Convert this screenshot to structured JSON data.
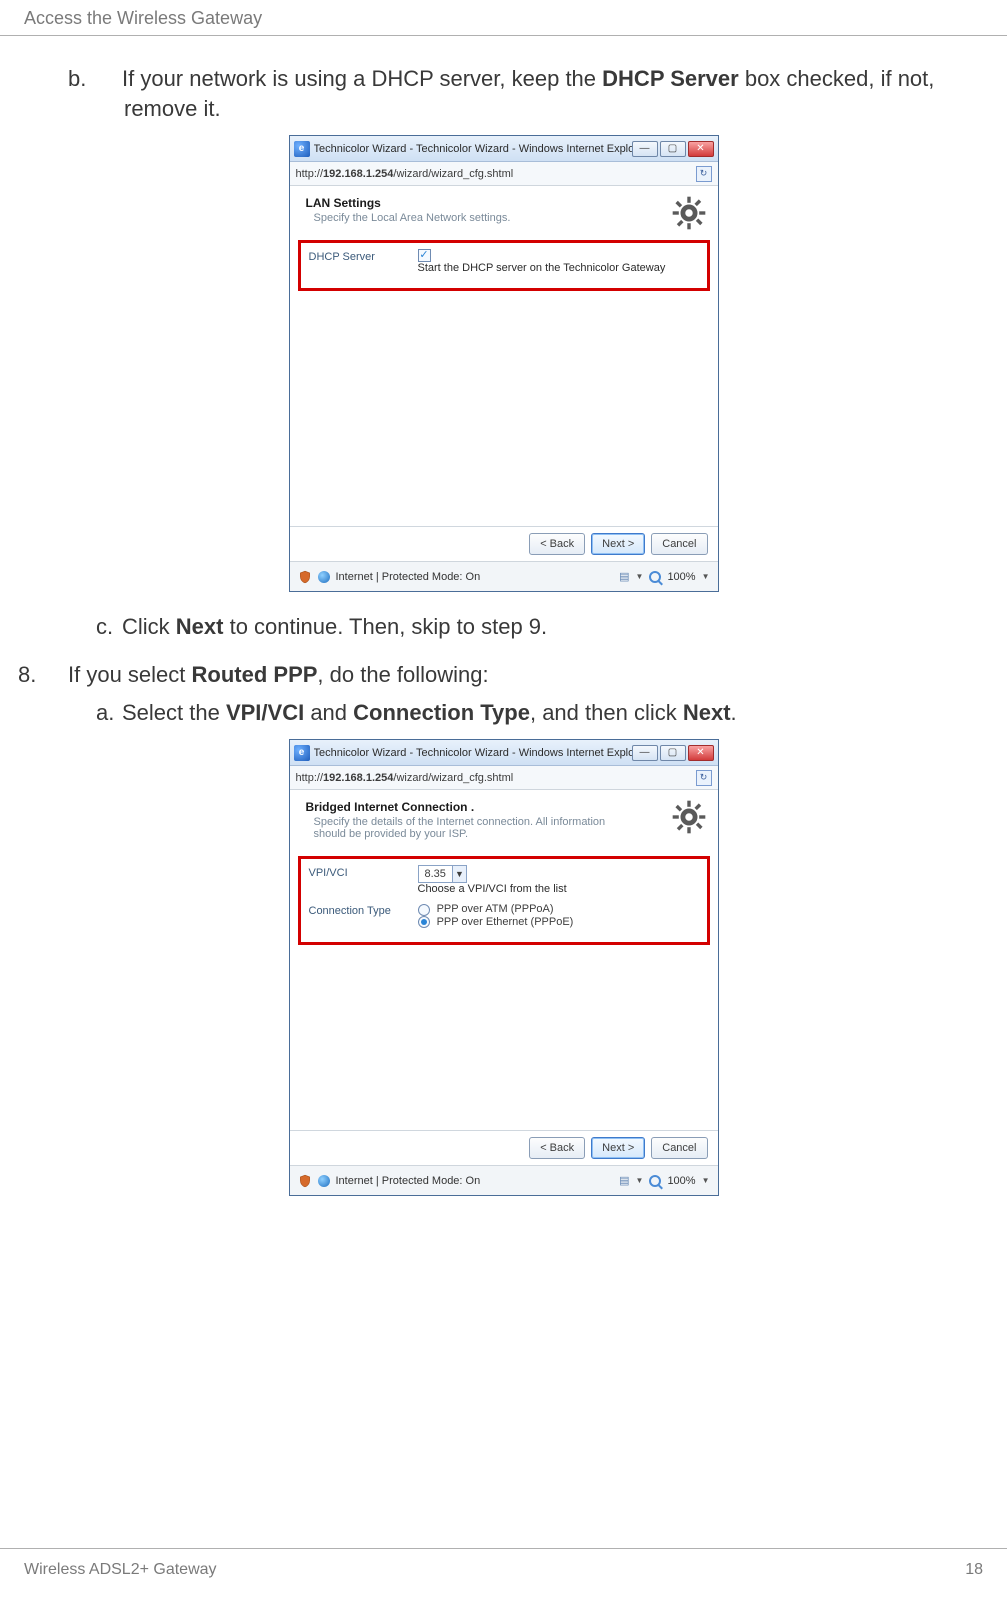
{
  "header": {
    "title": "Access the Wireless Gateway"
  },
  "body": {
    "b_marker": "b.",
    "b_text_1": "If your network is using a DHCP server, keep the ",
    "b_bold": "DHCP Server",
    "b_text_2": " box checked, if not, remove it.",
    "c_marker": "c.",
    "c_text_1": "Click ",
    "c_bold": "Next",
    "c_text_2": " to continue. Then, skip to step 9.",
    "n8_marker": "8.",
    "n8_text_1": "If you select ",
    "n8_bold": "Routed PPP",
    "n8_text_2": ", do the following:",
    "a_marker": "a.",
    "a_text_1": "Select the ",
    "a_bold_1": "VPI/VCI",
    "a_text_2": " and ",
    "a_bold_2": "Connection Type",
    "a_text_3": ", and then click ",
    "a_bold_3": "Next",
    "a_text_4": "."
  },
  "ie": {
    "window_title": "Technicolor Wizard - Technicolor Wizard - Windows Internet Explorer",
    "winbtn_min": "—",
    "winbtn_max": "▢",
    "winbtn_close": "✕",
    "url_prefix": "http://",
    "url_host": "192.168.1.254",
    "url_path": "/wizard/wizard_cfg.shtml",
    "lan": {
      "title": "LAN Settings",
      "subtitle": "Specify the Local Area Network settings.",
      "dhcp_label": "DHCP Server",
      "dhcp_hint": "Start the DHCP server on the Technicolor Gateway"
    },
    "bridged": {
      "title": "Bridged Internet Connection .",
      "subtitle": "Specify the details of the Internet connection. All information should be provided by your ISP.",
      "vpivci_label": "VPI/VCI",
      "vpivci_value": "8.35",
      "vpivci_hint": "Choose a VPI/VCI from the list",
      "conntype_label": "Connection Type",
      "conn_opt1": "PPP over ATM (PPPoA)",
      "conn_opt2": "PPP over Ethernet (PPPoE)"
    },
    "buttons": {
      "back": "< Back",
      "next": "Next >",
      "cancel": "Cancel"
    },
    "status": {
      "mode": "Internet | Protected Mode: On",
      "zoom": "100%"
    }
  },
  "footer": {
    "left": "Wireless ADSL2+ Gateway",
    "right": "18"
  }
}
